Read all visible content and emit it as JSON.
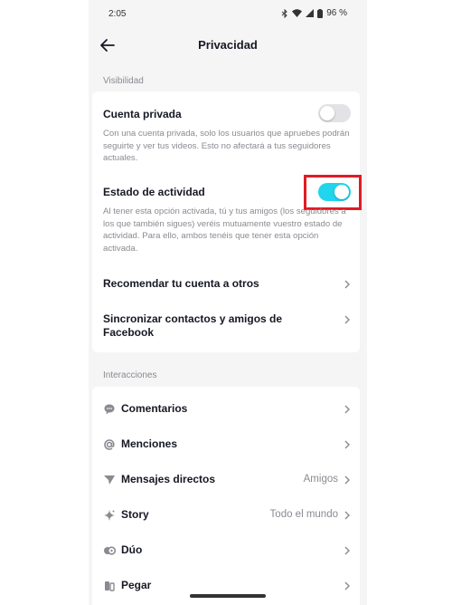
{
  "status_bar": {
    "time": "2:05",
    "battery": "96 %"
  },
  "header": {
    "title": "Privacidad"
  },
  "visibility": {
    "section_label": "Visibilidad",
    "private_account": {
      "title": "Cuenta privada",
      "description": "Con una cuenta privada, solo los usuarios que apruebes podrán seguirte y ver tus videos. Esto no afectará a tus seguidores actuales.",
      "enabled": false
    },
    "activity_status": {
      "title": "Estado de actividad",
      "description": "Al tener esta opción activada, tú y tus amigos (los seguidores a los que también sigues) veréis mutuamente vuestro estado de actividad. Para ello, ambos tenéis que tener esta opción activada.",
      "enabled": true
    },
    "recommend": {
      "title": "Recomendar tu cuenta a otros"
    },
    "sync": {
      "title": "Sincronizar contactos y amigos de Facebook"
    }
  },
  "interactions": {
    "section_label": "Interacciones",
    "items": [
      {
        "label": "Comentarios",
        "value": "",
        "icon": "comment-icon"
      },
      {
        "label": "Menciones",
        "value": "",
        "icon": "at-icon"
      },
      {
        "label": "Mensajes directos",
        "value": "Amigos",
        "icon": "send-icon"
      },
      {
        "label": "Story",
        "value": "Todo el mundo",
        "icon": "sparkle-icon"
      },
      {
        "label": "Dúo",
        "value": "",
        "icon": "duet-icon"
      },
      {
        "label": "Pegar",
        "value": "",
        "icon": "stitch-icon"
      }
    ]
  },
  "colors": {
    "accent": "#20d5ec",
    "highlight": "#e01b24",
    "text": "#161823",
    "muted": "#8a8b91"
  }
}
